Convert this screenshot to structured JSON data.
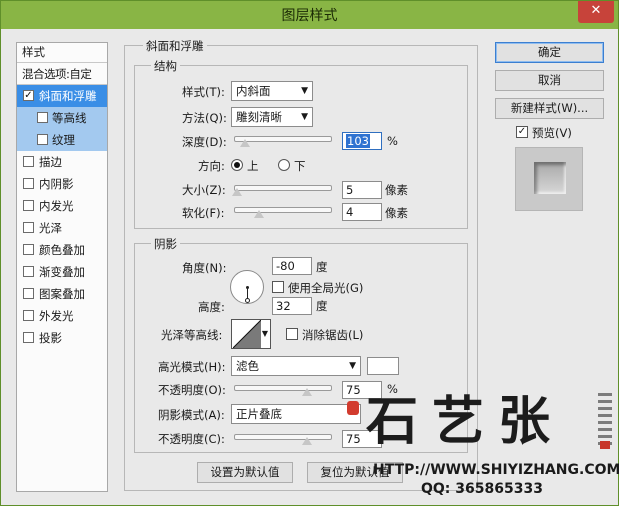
{
  "window": {
    "title": "图层样式",
    "close_glyph": "✕"
  },
  "style_list": {
    "header": "样式",
    "blend_options": "混合选项:自定",
    "items": [
      {
        "label": "斜面和浮雕",
        "checked": true,
        "selected": true,
        "sub": false
      },
      {
        "label": "等高线",
        "checked": false,
        "selected": false,
        "sub": true
      },
      {
        "label": "纹理",
        "checked": false,
        "selected": false,
        "sub": true
      },
      {
        "label": "描边",
        "checked": false,
        "sub": false
      },
      {
        "label": "内阴影",
        "checked": false,
        "sub": false
      },
      {
        "label": "内发光",
        "checked": false,
        "sub": false
      },
      {
        "label": "光泽",
        "checked": false,
        "sub": false
      },
      {
        "label": "颜色叠加",
        "checked": false,
        "sub": false
      },
      {
        "label": "渐变叠加",
        "checked": false,
        "sub": false
      },
      {
        "label": "图案叠加",
        "checked": false,
        "sub": false
      },
      {
        "label": "外发光",
        "checked": false,
        "sub": false
      },
      {
        "label": "投影",
        "checked": false,
        "sub": false
      }
    ]
  },
  "bevel": {
    "group_title": "斜面和浮雕",
    "structure_title": "结构",
    "style_label": "样式(T):",
    "style_value": "内斜面",
    "technique_label": "方法(Q):",
    "technique_value": "雕刻清晰",
    "depth_label": "深度(D):",
    "depth_value": "103",
    "depth_unit": "%",
    "depth_level": 0.103,
    "direction_label": "方向:",
    "direction_up": "上",
    "direction_down": "下",
    "size_label": "大小(Z):",
    "size_value": "5",
    "size_unit": "像素",
    "size_level": 0.02,
    "soften_label": "软化(F):",
    "soften_value": "4",
    "soften_unit": "像素",
    "soften_level": 0.25
  },
  "shading": {
    "title": "阴影",
    "angle_label": "角度(N):",
    "angle_value": "-80",
    "angle_unit": "度",
    "global_light_label": "使用全局光(G)",
    "altitude_label": "高度:",
    "altitude_value": "32",
    "altitude_unit": "度",
    "gloss_contour_label": "光泽等高线:",
    "antialias_label": "消除锯齿(L)",
    "highlight_mode_label": "高光模式(H):",
    "highlight_mode_value": "滤色",
    "highlight_color": "#ffffff",
    "highlight_opacity_label": "不透明度(O):",
    "highlight_opacity_value": "75",
    "highlight_opacity_unit": "%",
    "highlight_opacity_level": 0.75,
    "shadow_mode_label": "阴影模式(A):",
    "shadow_mode_value": "正片叠底",
    "shadow_opacity_label": "不透明度(C):",
    "shadow_opacity_value": "75",
    "shadow_opacity_level": 0.75
  },
  "bottom_buttons": {
    "set_default": "设置为默认值",
    "reset_default": "复位为默认值"
  },
  "right_panel": {
    "ok": "确定",
    "cancel": "取消",
    "new_style": "新建样式(W)...",
    "preview_label": "预览(V)",
    "preview_checked": true
  },
  "watermark": {
    "url": "HTTP://WWW.SHIYIZHANG.COM",
    "qq": "QQ: 365865333"
  },
  "colors": {
    "titlebar": "#89b545",
    "selection": "#3a8ee6",
    "close": "#c7433a"
  }
}
